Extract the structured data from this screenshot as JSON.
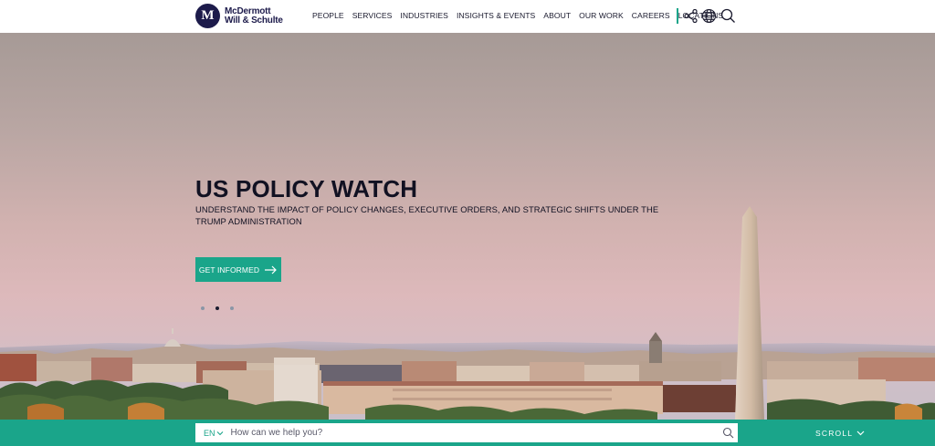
{
  "brand": {
    "logo_letter": "M",
    "name_line1": "McDermott",
    "name_line2": "Will & Schulte"
  },
  "nav": {
    "items": [
      {
        "label": "PEOPLE"
      },
      {
        "label": "SERVICES"
      },
      {
        "label": "INDUSTRIES"
      },
      {
        "label": "INSIGHTS & EVENTS"
      },
      {
        "label": "ABOUT"
      },
      {
        "label": "OUR WORK"
      },
      {
        "label": "CAREERS"
      },
      {
        "label": "LOCATIONS"
      }
    ],
    "icons": [
      "share-icon",
      "globe-icon",
      "search-icon"
    ]
  },
  "hero": {
    "title": "US POLICY WATCH",
    "subtitle": "UNDERSTAND THE IMPACT OF POLICY CHANGES, EXECUTIVE ORDERS, AND STRATEGIC SHIFTS UNDER THE TRUMP ADMINISTRATION",
    "cta_label": "GET INFORMED",
    "carousel": {
      "slides": 3,
      "active": 2
    }
  },
  "search_bar": {
    "language": "EN",
    "placeholder": "How can we help you?"
  },
  "scroll_label": "SCROLL",
  "colors": {
    "accent": "#1aa58a",
    "brand_navy": "#1d1b4b",
    "text_dark": "#111122"
  }
}
